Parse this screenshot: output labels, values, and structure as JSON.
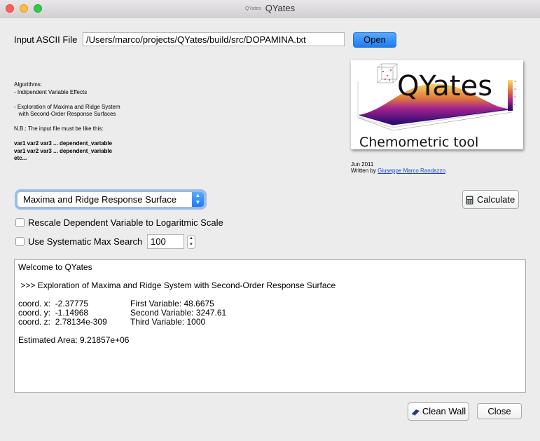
{
  "window": {
    "title": "QYates",
    "title_icon": "QYates"
  },
  "input_file": {
    "label": "Input ASCII File",
    "path": "/Users/marco/projects/QYates/build/src/DOPAMINA.txt",
    "open_label": "Open"
  },
  "info": {
    "lines": [
      "Algorithms:",
      "- Indipendent Variable Effects",
      "",
      "- Exploration of Maxima and Ridge System",
      "   with Second-Order Response Surfaces",
      "",
      "N.B.: The input file must be like this:",
      "",
      "var1 var2 var3 ... dependent_variable",
      "var1 var2 var3 ... dependent_variable",
      "etc..."
    ]
  },
  "logo": {
    "title": "QYates",
    "subtitle": "Chemometric tool",
    "colors": {
      "accent": "#7a1fa0",
      "surface_low": "#2a0a7a",
      "surface_high": "#f2c24a"
    }
  },
  "credits": {
    "date": "Jun 2011",
    "written_by": "Written by",
    "author": "Giuseppe Marco Randazzo"
  },
  "controls": {
    "algorithm_select": "Maxima and Ridge Response Surface",
    "calculate_label": "Calculate",
    "rescale_label": "Rescale Dependent Variable to Logaritmic Scale",
    "systematic_label": "Use Systematic Max Search",
    "systematic_value": "100",
    "rescale_checked": false,
    "systematic_checked": false
  },
  "output": {
    "welcome": "Welcome to QYates",
    "heading": " >>> Exploration of Maxima and Ridge System with Second-Order Response Surface",
    "coords": [
      {
        "coord": "coord. x:  -2.37775",
        "variable": "First Variable: 48.6675"
      },
      {
        "coord": "coord. y:  -1.14968",
        "variable": "Second Variable: 3247.61"
      },
      {
        "coord": "coord. z:  2.78134e-309",
        "variable": "Third Variable: 1000"
      }
    ],
    "area": "Estimated Area: 9.21857e+06"
  },
  "footer": {
    "clean_label": "Clean Wall",
    "close_label": "Close"
  }
}
